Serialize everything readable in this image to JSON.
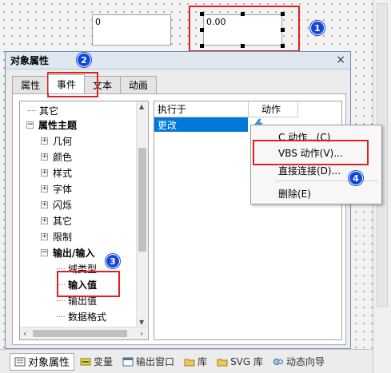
{
  "canvas": {
    "field1_value": "0",
    "field2_value": "0.00"
  },
  "badges": [
    "1",
    "2",
    "3",
    "4"
  ],
  "dialog": {
    "title": "对象属性",
    "close": "×",
    "tabs": [
      {
        "label": "属性"
      },
      {
        "label": "事件"
      },
      {
        "label": "文本"
      },
      {
        "label": "动画"
      }
    ]
  },
  "tree": {
    "items": [
      {
        "label": "其它",
        "expander": "",
        "level": 0
      },
      {
        "label": "属性主题",
        "expander": "−",
        "level": 0,
        "bold": true
      },
      {
        "label": "几何",
        "expander": "+",
        "level": 1
      },
      {
        "label": "颜色",
        "expander": "+",
        "level": 1
      },
      {
        "label": "样式",
        "expander": "+",
        "level": 1
      },
      {
        "label": "字体",
        "expander": "+",
        "level": 1
      },
      {
        "label": "闪烁",
        "expander": "+",
        "level": 1
      },
      {
        "label": "其它",
        "expander": "+",
        "level": 1
      },
      {
        "label": "限制",
        "expander": "+",
        "level": 1
      },
      {
        "label": "输出/输入",
        "expander": "−",
        "level": 1,
        "bold": true
      },
      {
        "label": "域类型",
        "expander": "",
        "level": 2
      },
      {
        "label": "输入值",
        "expander": "",
        "level": 2,
        "bold": true
      },
      {
        "label": "输出值",
        "expander": "",
        "level": 2
      },
      {
        "label": "数据格式",
        "expander": "",
        "level": 2
      }
    ]
  },
  "events": {
    "col_trigger": "执行于",
    "col_action": "动作",
    "selected_row": "更改"
  },
  "context_menu": {
    "items": [
      "C 动作...(C)",
      "VBS 动作(V)...",
      "直接连接(D)...",
      "删除(E)"
    ]
  },
  "bottom_tabs": [
    {
      "label": "对象属性",
      "active": true
    },
    {
      "label": "变量"
    },
    {
      "label": "输出窗口"
    },
    {
      "label": "库"
    },
    {
      "label": "SVG 库"
    },
    {
      "label": "动态向导"
    }
  ],
  "colors": {
    "highlight_red": "#e02020",
    "badge_blue": "#1347d6",
    "selection_blue": "#0078d7",
    "lightning_blue": "#2aa3e6"
  }
}
